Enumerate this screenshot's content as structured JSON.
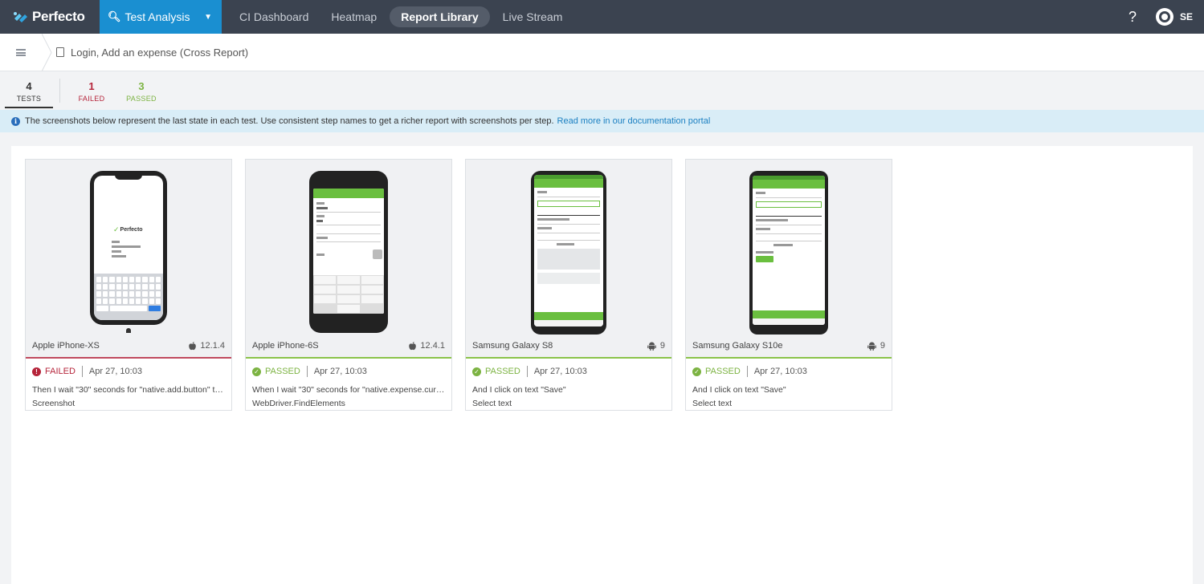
{
  "brand": {
    "name": "Perfecto"
  },
  "nav": {
    "active": "Test Analysis",
    "items": [
      "CI Dashboard",
      "Heatmap",
      "Report Library",
      "Live Stream"
    ],
    "selected_pill": "Report Library",
    "help": "?",
    "user_initials": "SE"
  },
  "breadcrumb": {
    "title": "Login, Add an expense (Cross Report)"
  },
  "counters": {
    "tests": {
      "value": "4",
      "label": "TESTS"
    },
    "failed": {
      "value": "1",
      "label": "FAILED"
    },
    "passed": {
      "value": "3",
      "label": "PASSED"
    }
  },
  "info": {
    "text": "The screenshots below represent the last state in each test. Use consistent step names to get a richer report with screenshots per step.",
    "link": "Read more in our documentation portal"
  },
  "cards": [
    {
      "device": "Apple iPhone-XS",
      "os_icon": "apple-icon",
      "os_version": "12.1.4",
      "status": "FAILED",
      "date": "Apr 27, 10:03",
      "step1": "Then I wait \"30\" seconds for \"native.add.button\" to a...",
      "step2": "Screenshot"
    },
    {
      "device": "Apple iPhone-6S",
      "os_icon": "apple-icon",
      "os_version": "12.4.1",
      "status": "PASSED",
      "date": "Apr 27, 10:03",
      "step1": "When I wait \"30\" seconds for \"native.expense.curren...",
      "step2": "WebDriver.FindElements"
    },
    {
      "device": "Samsung Galaxy S8",
      "os_icon": "android-icon",
      "os_version": "9",
      "status": "PASSED",
      "date": "Apr 27, 10:03",
      "step1": "And I click on text \"Save\"",
      "step2": "Select text"
    },
    {
      "device": "Samsung Galaxy S10e",
      "os_icon": "android-icon",
      "os_version": "9",
      "status": "PASSED",
      "date": "Apr 27, 10:03",
      "step1": "And I click on text \"Save\"",
      "step2": "Select text"
    }
  ],
  "colors": {
    "topbar": "#3b4350",
    "accent": "#1a8fd1",
    "failed": "#b5243a",
    "passed": "#7cb342",
    "info_bg": "#d9edf7"
  }
}
